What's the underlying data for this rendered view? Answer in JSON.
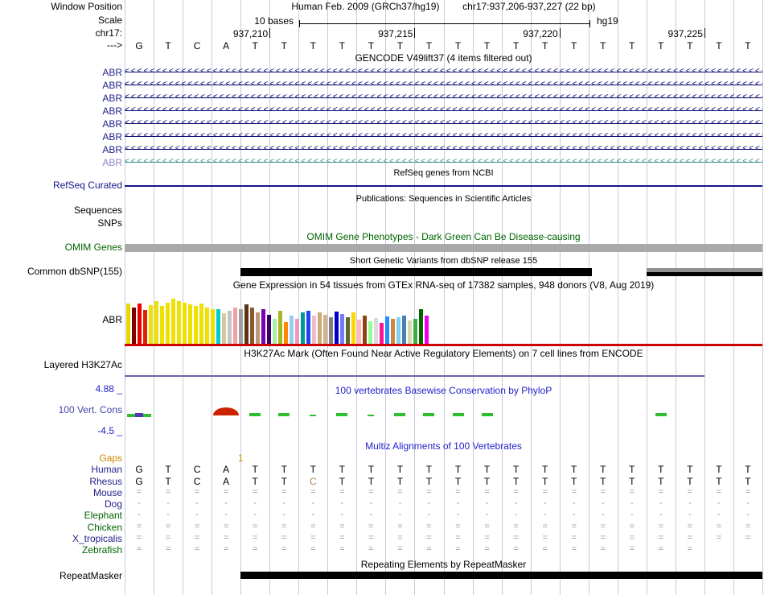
{
  "colors": {
    "grid": "#c9c9da",
    "black": "#000000",
    "title_blue": "#2222cc",
    "gencode": "#0c0c78",
    "gencode_light": "#3f8f8f",
    "gencode_label": "#22228c",
    "gencode_light_label": "#8888cc",
    "refseq_line": "#14148c",
    "refseq_label": "#14148c",
    "omim_green": "#006400",
    "omim_bar": "#a9a9a9",
    "dbsnp_black": "#000000",
    "dbsnp_gray": "#909090",
    "gtex_line": "#cc0000",
    "h3k27_line": "#6666aa",
    "phylop_green": "#2fbe2f",
    "phylop_red": "#cc2200",
    "phylop_clip": "#5533bb",
    "axis_blue": "#2222cc",
    "vertcons_label": "#4444aa",
    "gaps_orange": "#cc8800",
    "species_blue": "#22228c",
    "species_green": "#006400",
    "symbol_gray": "#999999",
    "rhesus_diff": "#aa8855"
  },
  "header": {
    "window_position_label": "Window Position",
    "assembly_text": "Human Feb. 2009 (GRCh37/hg19)",
    "position_text": "chr17:937,206-937,227 (22 bp)",
    "scale_label": "Scale",
    "scale_value": "10 bases",
    "scale_assembly": "hg19",
    "chrom_label": "chr17:",
    "strand_label": "--->",
    "ticks": [
      {
        "text": "937,210",
        "col": 5
      },
      {
        "text": "937,215",
        "col": 10
      },
      {
        "text": "937,220",
        "col": 15
      },
      {
        "text": "937,225",
        "col": 20
      }
    ],
    "sequence": [
      "G",
      "T",
      "C",
      "A",
      "T",
      "T",
      "T",
      "T",
      "T",
      "T",
      "T",
      "T",
      "T",
      "T",
      "T",
      "T",
      "T",
      "T",
      "T",
      "T",
      "T",
      "T"
    ]
  },
  "gencode": {
    "title": "GENCODE V49lift37 (4 items filtered out)",
    "strand_char": "<",
    "items": [
      {
        "label": "ABR",
        "style": "dark"
      },
      {
        "label": "ABR",
        "style": "dark"
      },
      {
        "label": "ABR",
        "style": "dark"
      },
      {
        "label": "ABR",
        "style": "dark"
      },
      {
        "label": "ABR",
        "style": "dark"
      },
      {
        "label": "ABR",
        "style": "dark"
      },
      {
        "label": "ABR",
        "style": "dark"
      },
      {
        "label": "ABR",
        "style": "light"
      }
    ]
  },
  "refseq": {
    "title": "RefSeq genes from NCBI",
    "label": "RefSeq Curated"
  },
  "publications": {
    "title": "Publications: Sequences in Scientific Articles",
    "sequences_label": "Sequences",
    "snps_label": "SNPs"
  },
  "omim": {
    "title": "OMIM Gene Phenotypes - Dark Green Can Be Disease-causing",
    "label": "OMIM Genes"
  },
  "dbsnp": {
    "title": "Short Genetic Variants from dbSNP release 155",
    "label": "Common dbSNP(155)"
  },
  "gtex": {
    "title": "Gene Expression in 54 tissues from GTEx RNA-seq of 17382 samples, 948 donors (V8, Aug 2019)",
    "label": "ABR"
  },
  "h3k27ac": {
    "title": "H3K27Ac Mark (Often Found Near Active Regulatory Elements) on 7 cell lines from ENCODE",
    "label": "Layered H3K27Ac"
  },
  "phylop": {
    "title": "100 vertebrates Basewise Conservation by PhyloP",
    "label": "100 Vert. Cons",
    "max_label": "4.88 _",
    "min_label": "-4.5 _",
    "marks": [
      {
        "col": 0,
        "type": "wide-green"
      },
      {
        "col": 0,
        "type": "purple-dot"
      },
      {
        "col": 3,
        "type": "red-arc"
      },
      {
        "col": 4,
        "type": "green"
      },
      {
        "col": 5,
        "type": "green"
      },
      {
        "col": 6,
        "type": "green-small"
      },
      {
        "col": 7,
        "type": "green"
      },
      {
        "col": 8,
        "type": "green-small"
      },
      {
        "col": 9,
        "type": "green"
      },
      {
        "col": 10,
        "type": "green"
      },
      {
        "col": 11,
        "type": "green"
      },
      {
        "col": 12,
        "type": "green"
      },
      {
        "col": 18,
        "type": "green"
      }
    ]
  },
  "multiz": {
    "title": "Multiz Alignments of 100 Vertebrates",
    "rows": [
      {
        "id": "gaps",
        "label": "Gaps",
        "color": "#cc8800",
        "cell_color": "#cc8800",
        "boundary": true,
        "cells": [
          "",
          "",
          "",
          "",
          "1",
          "",
          "",
          "",
          "",
          "",
          "",
          "",
          "",
          "",
          "",
          "",
          "",
          "",
          "",
          "",
          "",
          ""
        ]
      },
      {
        "id": "human",
        "label": "Human",
        "color": "#22228c",
        "cell_color": "#000000",
        "cells": [
          "G",
          "T",
          "C",
          "A",
          "T",
          "T",
          "T",
          "T",
          "T",
          "T",
          "T",
          "T",
          "T",
          "T",
          "T",
          "T",
          "T",
          "T",
          "T",
          "T",
          "T",
          "T"
        ]
      },
      {
        "id": "rhesus",
        "label": "Rhesus",
        "color": "#22228c",
        "cell_color": "#000000",
        "diff_cols": [
          6
        ],
        "diff_color": "#aa8855",
        "cells": [
          "G",
          "T",
          "C",
          "A",
          "T",
          "T",
          "C",
          "T",
          "T",
          "T",
          "T",
          "T",
          "T",
          "T",
          "T",
          "T",
          "T",
          "T",
          "T",
          "T",
          "T",
          "T"
        ]
      },
      {
        "id": "mouse",
        "label": "Mouse",
        "color": "#22228c",
        "cell_color": "#999999",
        "cells": [
          "=",
          "=",
          "=",
          "=",
          "=",
          "=",
          "=",
          "=",
          "=",
          "=",
          "=",
          "=",
          "=",
          "=",
          "=",
          "=",
          "=",
          "=",
          "=",
          "=",
          "=",
          "="
        ]
      },
      {
        "id": "dog",
        "label": "Dog",
        "color": "#22228c",
        "cell_color": "#999999",
        "cells": [
          "-",
          "-",
          "-",
          "-",
          "-",
          "-",
          "-",
          "-",
          "-",
          "-",
          "-",
          "-",
          "-",
          "-",
          "-",
          "-",
          "-",
          "-",
          "-",
          "-",
          "-",
          "-"
        ]
      },
      {
        "id": "elephant",
        "label": "Elephant",
        "color": "#006400",
        "cell_color": "#999999",
        "cells": [
          "-",
          "-",
          "-",
          "-",
          "-",
          "-",
          "-",
          "-",
          "-",
          "-",
          "-",
          "-",
          "-",
          "-",
          "-",
          "-",
          "-",
          "-",
          "-",
          "-",
          "-",
          "-"
        ]
      },
      {
        "id": "chicken",
        "label": "Chicken",
        "color": "#006400",
        "cell_color": "#999999",
        "cells": [
          "=",
          "=",
          "=",
          "=",
          "=",
          "=",
          "=",
          "=",
          "=",
          "=",
          "=",
          "=",
          "=",
          "=",
          "=",
          "=",
          "=",
          "=",
          "=",
          "=",
          "=",
          "="
        ]
      },
      {
        "id": "x_tropicalis",
        "label": "X_tropicalis",
        "color": "#22228c",
        "cell_color": "#999999",
        "cells": [
          "=",
          "=",
          "=",
          "=",
          "=",
          "=",
          "=",
          "=",
          "=",
          "=",
          "=",
          "=",
          "=",
          "=",
          "=",
          "=",
          "=",
          "=",
          "=",
          "=",
          "=",
          "="
        ]
      },
      {
        "id": "zebrafish",
        "label": "Zebrafish",
        "color": "#006400",
        "cell_color": "#999999",
        "cells": [
          "=",
          "=",
          "=",
          "=",
          "=",
          "=",
          "=",
          "=",
          "=",
          "=",
          "=",
          "=",
          "=",
          "=",
          "=",
          "=",
          "=",
          "=",
          "=",
          "=",
          "",
          ""
        ]
      }
    ]
  },
  "repeatmasker": {
    "title": "Repeating Elements by RepeatMasker",
    "label": "RepeatMasker"
  },
  "chart_data": {
    "type": "bar",
    "title": "Gene Expression in 54 tissues from GTEx RNA-seq of 17382 samples, 948 donors (V8, Aug 2019)",
    "gene": "ABR",
    "n_tissues": 54,
    "values": [
      50,
      45,
      50,
      42,
      48,
      53,
      47,
      51,
      56,
      53,
      51,
      49,
      47,
      50,
      45,
      43,
      43,
      38,
      41,
      45,
      43,
      49,
      45,
      39,
      43,
      36,
      31,
      41,
      27,
      35,
      31,
      39,
      41,
      35,
      39,
      36,
      33,
      40,
      37,
      33,
      39,
      30,
      35,
      28,
      32,
      26,
      34,
      31,
      33,
      35,
      29,
      31,
      43,
      35
    ],
    "colors": [
      "#E6D800",
      "#800000",
      "#EE0000",
      "#DD2200",
      "#EEE000",
      "#EEE000",
      "#EEE000",
      "#EEE000",
      "#EEE000",
      "#EEE000",
      "#EEE000",
      "#EEE000",
      "#EEE000",
      "#EEE000",
      "#EEE000",
      "#EEE000",
      "#00CCCC",
      "#D6C89B",
      "#C4C4C4",
      "#EEA2A2",
      "#A0A0A0",
      "#5C3317",
      "#8B5A2B",
      "#BB9977",
      "#7A00B0",
      "#3D0066",
      "#AAEEAA",
      "#A8B820",
      "#FF8800",
      "#99CCEE",
      "#EE99BB",
      "#009999",
      "#2244EE",
      "#EEBBCC",
      "#CCAA77",
      "#D2B48C",
      "#808080",
      "#0000CC",
      "#7777FF",
      "#556B2F",
      "#FFD700",
      "#FFB6C1",
      "#8B4513",
      "#98FB98",
      "#DCDCDC",
      "#FF1493",
      "#1E90FF",
      "#CD853F",
      "#87CEEB",
      "#4682B4",
      "#D8D8B0",
      "#44AA44",
      "#006600",
      "#EE00EE"
    ]
  }
}
